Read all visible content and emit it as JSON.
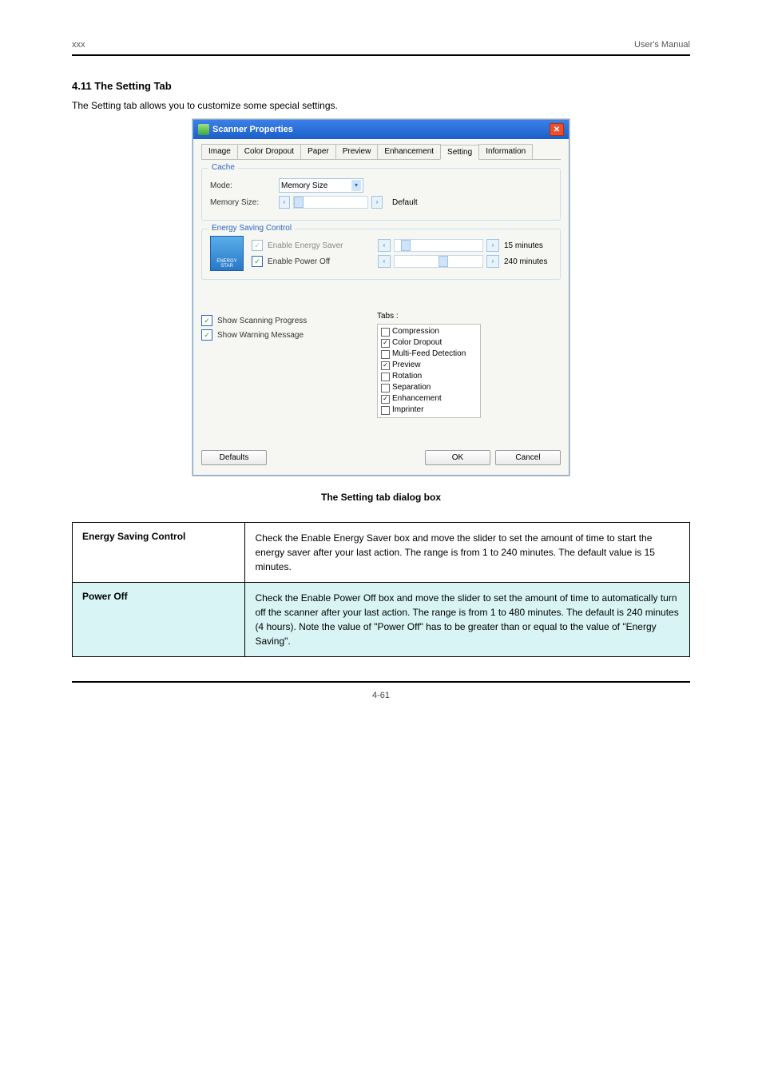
{
  "header": {
    "left": "xxx",
    "right": "User's Manual"
  },
  "section_title": "4.11 The Setting Tab",
  "section_intro": "The Setting tab allows you to customize some special settings.",
  "window": {
    "title": "Scanner Properties",
    "tabs": [
      "Image",
      "Color Dropout",
      "Paper",
      "Preview",
      "Enhancement",
      "Setting",
      "Information"
    ],
    "active_tab_index": 5,
    "cache": {
      "legend": "Cache",
      "mode_label": "Mode:",
      "mode_value": "Memory Size",
      "memsize_label": "Memory Size:",
      "memsize_value": "Default"
    },
    "energy": {
      "legend": "Energy Saving Control",
      "enable_saver": "Enable Energy Saver",
      "saver_value": "15 minutes",
      "enable_poweroff": "Enable Power Off",
      "poweroff_value": "240 minutes",
      "logo": "ENERGY STAR"
    },
    "show_progress": "Show Scanning Progress",
    "show_warning": "Show Warning Message",
    "tabs_title": "Tabs :",
    "tabs_list": [
      {
        "label": "Compression",
        "checked": false
      },
      {
        "label": "Color Dropout",
        "checked": true
      },
      {
        "label": "Multi-Feed Detection",
        "checked": false
      },
      {
        "label": "Preview",
        "checked": true
      },
      {
        "label": "Rotation",
        "checked": false
      },
      {
        "label": "Separation",
        "checked": false
      },
      {
        "label": "Enhancement",
        "checked": true
      },
      {
        "label": "Imprinter",
        "checked": false
      }
    ],
    "buttons": {
      "defaults": "Defaults",
      "ok": "OK",
      "cancel": "Cancel"
    }
  },
  "caption": "The Setting tab dialog box",
  "table": {
    "row1": {
      "title": "Energy Saving Control",
      "desc": "Check the Enable Energy Saver box and move the slider to set the amount of time to start the energy saver after your last action. The range is from 1 to 240 minutes. The default value is 15 minutes."
    },
    "row2": {
      "title": "Power Off",
      "desc": "Check the Enable Power Off box and move the slider to set the amount of time to automatically turn off the scanner after your last action. The range is from 1 to 480 minutes. The default is 240 minutes (4 hours). Note the value of \"Power Off\" has to be greater than or equal to the value of \"Energy Saving\"."
    }
  },
  "page_number": "4-61"
}
